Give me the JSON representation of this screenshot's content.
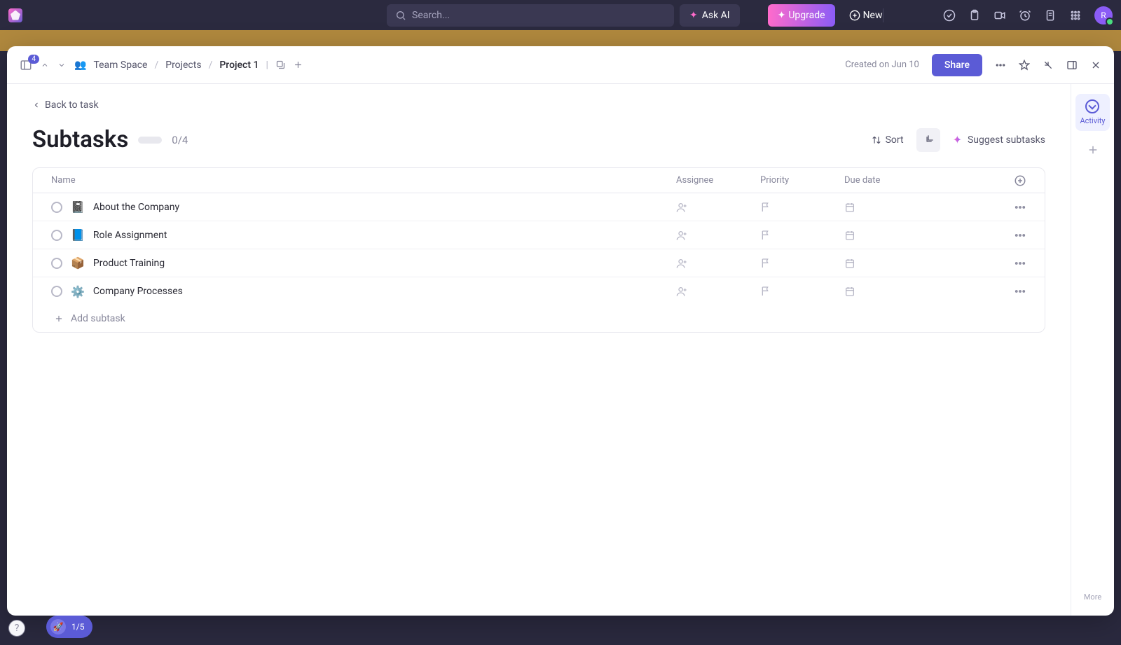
{
  "topbar": {
    "search_placeholder": "Search...",
    "ask_ai": "Ask AI",
    "upgrade": "Upgrade",
    "new": "New",
    "avatar_initial": "R"
  },
  "modal_header": {
    "sidebar_badge": "4",
    "crumbs": {
      "space": "Team Space",
      "folder": "Projects",
      "project": "Project 1"
    },
    "created_on": "Created on Jun 10",
    "share": "Share"
  },
  "back_link": "Back to task",
  "title": "Subtasks",
  "counter": "0/4",
  "actions": {
    "sort": "Sort",
    "suggest": "Suggest subtasks"
  },
  "columns": {
    "name": "Name",
    "assignee": "Assignee",
    "priority": "Priority",
    "due": "Due date"
  },
  "rows": [
    {
      "emoji": "📓",
      "name": "About the Company"
    },
    {
      "emoji": "📘",
      "name": "Role Assignment"
    },
    {
      "emoji": "📦",
      "name": "Product Training"
    },
    {
      "emoji": "⚙️",
      "name": "Company Processes"
    }
  ],
  "add_subtask": "Add subtask",
  "side": {
    "activity": "Activity",
    "more": "More"
  },
  "onboarding": "1/5"
}
